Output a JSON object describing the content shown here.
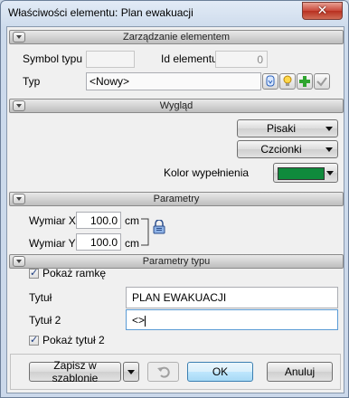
{
  "window": {
    "title": "Właściwości elementu: Plan ewakuacji",
    "close_glyph": "✕"
  },
  "sections": {
    "management": "Zarządzanie elementem",
    "appearance": "Wygląd",
    "parameters": "Parametry",
    "type_parameters": "Parametry typu"
  },
  "management": {
    "symbol_label": "Symbol typu",
    "symbol_value": "",
    "id_label": "Id elementu",
    "id_value": "0",
    "type_label": "Typ",
    "type_value": "<Nowy>"
  },
  "appearance": {
    "pens_label": "Pisaki",
    "fonts_label": "Czcionki",
    "fill_label": "Kolor wypełnienia",
    "fill_color": "#0f8a3c"
  },
  "parameters": {
    "width_label": "Wymiar X",
    "width_value": "100.0",
    "width_unit": "cm",
    "height_label": "Wymiar Y",
    "height_value": "100.0",
    "height_unit": "cm"
  },
  "type_parameters": {
    "show_frame_label": "Pokaż ramkę",
    "show_frame_checked": true,
    "title_label": "Tytuł",
    "title_value": "PLAN EWAKUACJI",
    "title2_label": "Tytuł 2",
    "title2_value": "<>",
    "show_title2_label": "Pokaż tytuł 2",
    "show_title2_checked": true
  },
  "footer": {
    "save_template_label": "Zapisz w szablonie",
    "ok_label": "OK",
    "cancel_label": "Anuluj"
  }
}
